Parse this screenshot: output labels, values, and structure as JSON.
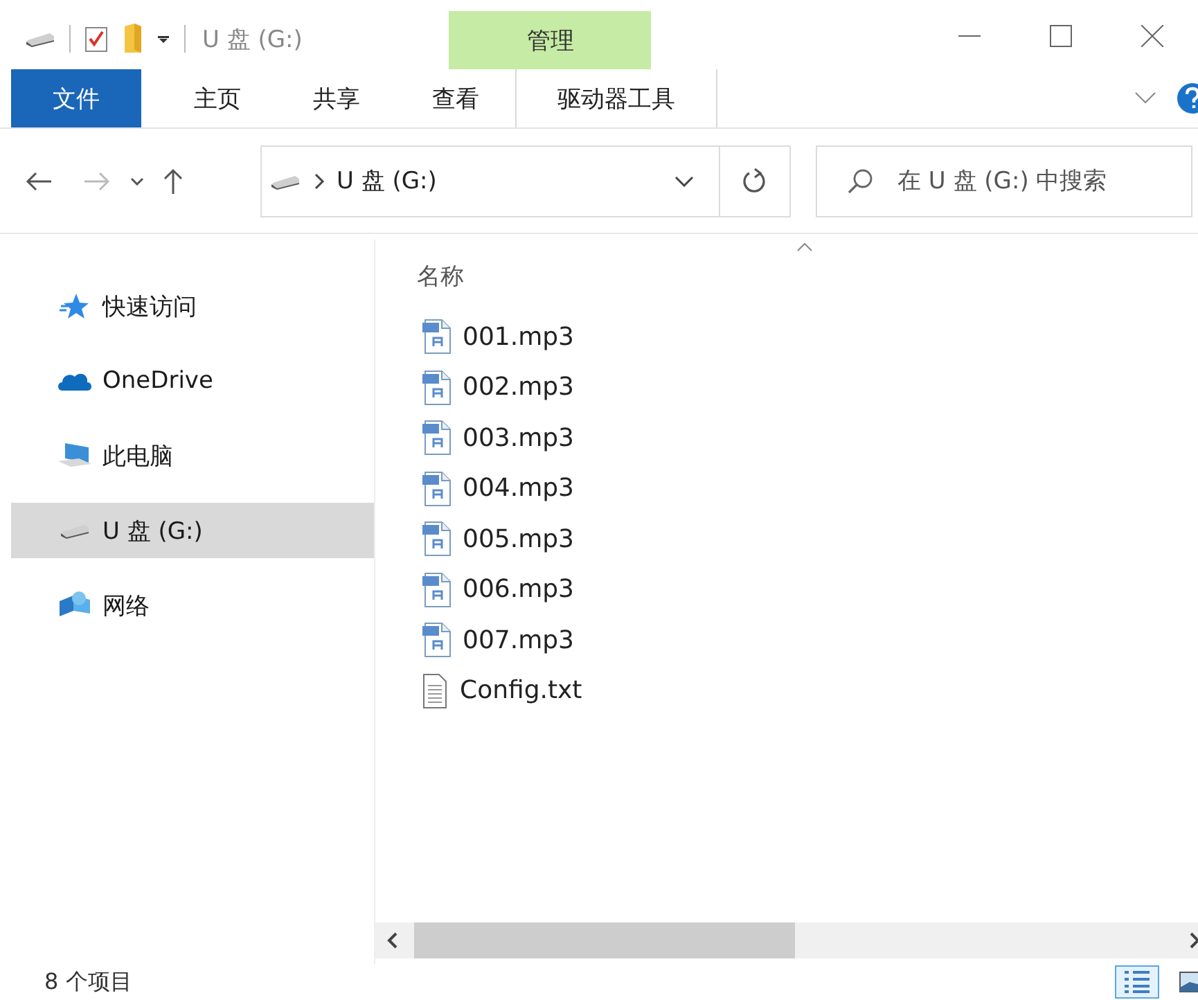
{
  "title_bar": {
    "title": "U 盘 (G:)",
    "context_group": "管理"
  },
  "ribbon": {
    "tabs": [
      {
        "label": "文件",
        "kind": "file"
      },
      {
        "label": "主页",
        "kind": "tab"
      },
      {
        "label": "共享",
        "kind": "tab"
      },
      {
        "label": "查看",
        "kind": "tab"
      },
      {
        "label": "驱动器工具",
        "kind": "context"
      }
    ]
  },
  "address_bar": {
    "path": "U 盘 (G:)"
  },
  "search": {
    "placeholder": "在 U 盘 (G:) 中搜索"
  },
  "nav": {
    "items": [
      {
        "label": "快速访问",
        "kind": "star",
        "selected": false
      },
      {
        "label": "OneDrive",
        "kind": "cloud",
        "selected": false
      },
      {
        "label": "此电脑",
        "kind": "computer",
        "selected": false
      },
      {
        "label": "U 盘 (G:)",
        "kind": "drive",
        "selected": true
      },
      {
        "label": "网络",
        "kind": "network",
        "selected": false
      }
    ]
  },
  "files": {
    "column": "名称",
    "items": [
      {
        "name": "001.mp3",
        "kind": "mp3"
      },
      {
        "name": "002.mp3",
        "kind": "mp3"
      },
      {
        "name": "003.mp3",
        "kind": "mp3"
      },
      {
        "name": "004.mp3",
        "kind": "mp3"
      },
      {
        "name": "005.mp3",
        "kind": "mp3"
      },
      {
        "name": "006.mp3",
        "kind": "mp3"
      },
      {
        "name": "007.mp3",
        "kind": "mp3"
      },
      {
        "name": "Config.txt",
        "kind": "txt"
      }
    ]
  },
  "status_bar": {
    "count": "8 个项目",
    "views": [
      {
        "kind": "details",
        "selected": true
      },
      {
        "kind": "tiles",
        "selected": false
      }
    ]
  }
}
